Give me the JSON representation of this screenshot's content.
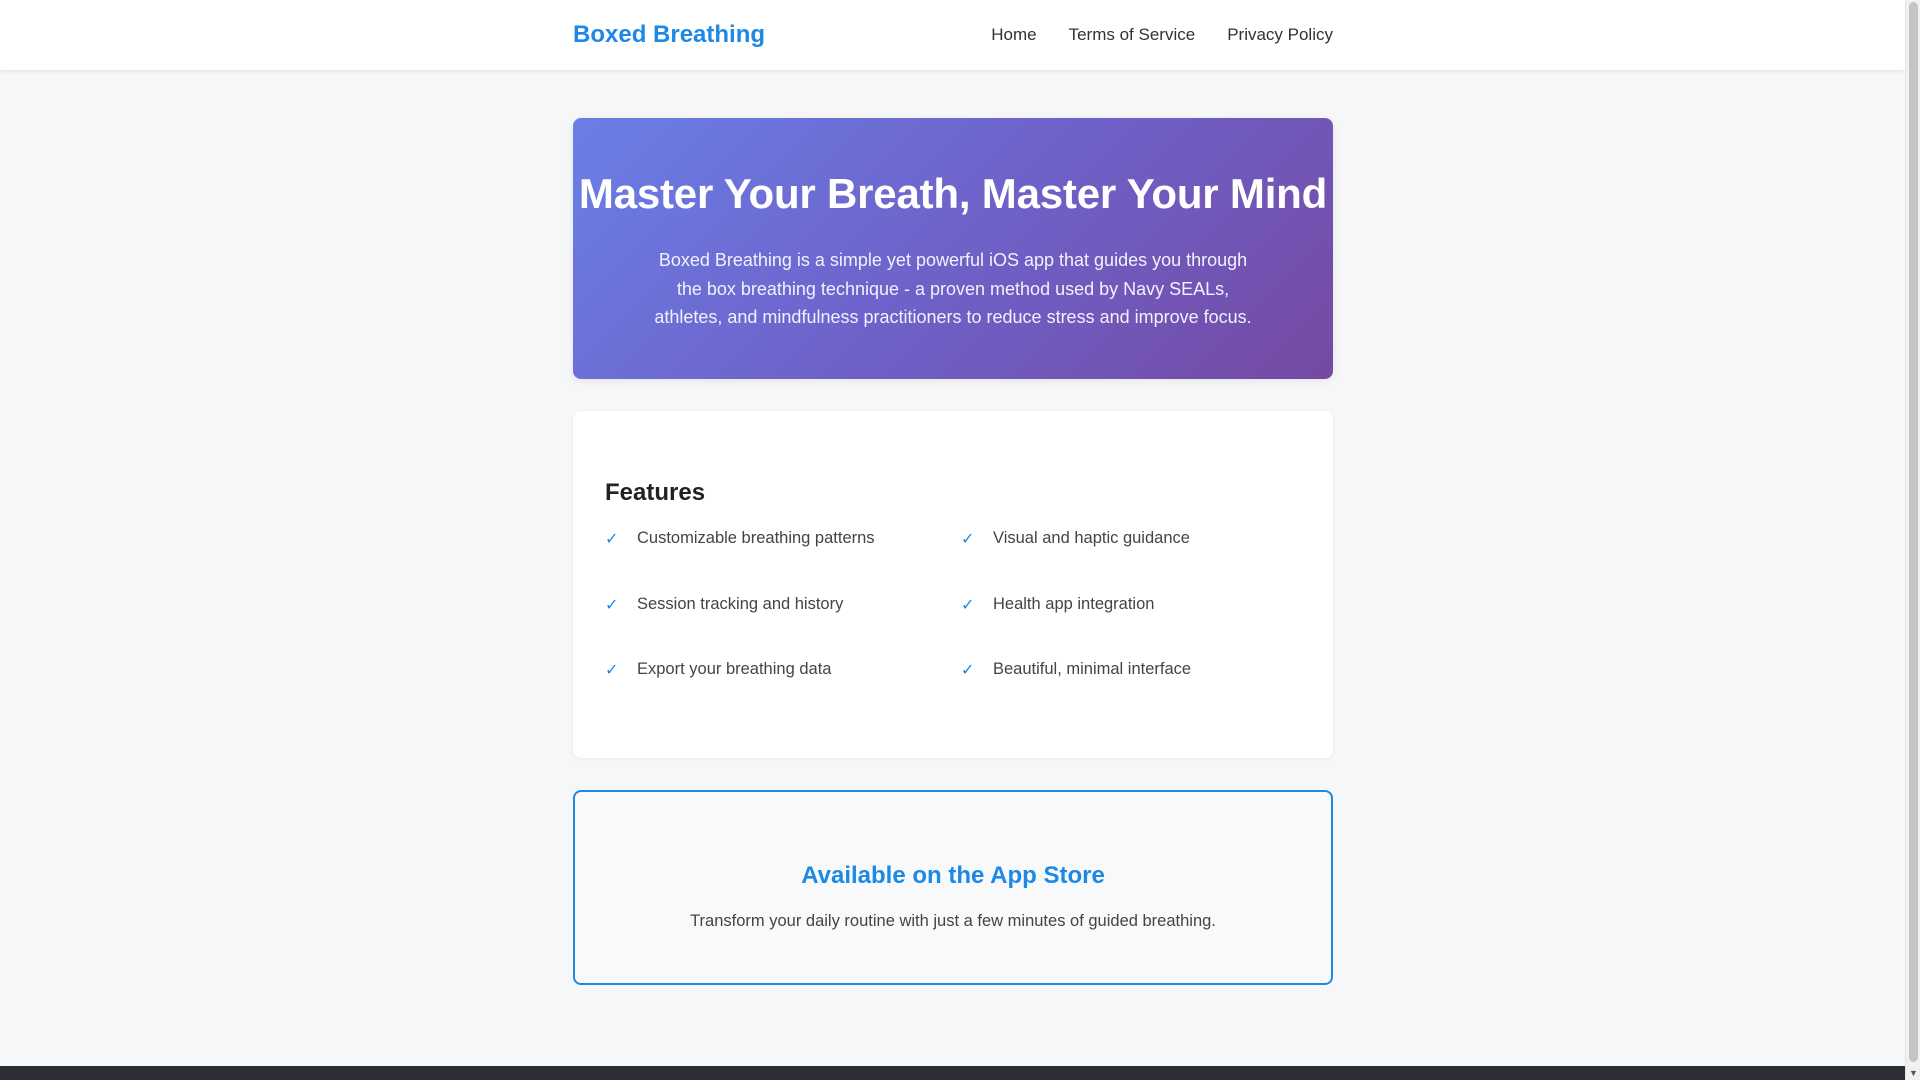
{
  "header": {
    "brand": "Boxed Breathing",
    "nav": [
      {
        "label": "Home"
      },
      {
        "label": "Terms of Service"
      },
      {
        "label": "Privacy Policy"
      }
    ]
  },
  "hero": {
    "title": "Master Your Breath, Master Your Mind",
    "description": "Boxed Breathing is a simple yet powerful iOS app that guides you through the box breathing technique - a proven method used by Navy SEALs, athletes, and mindfulness practitioners to reduce stress and improve focus."
  },
  "features": {
    "heading": "Features",
    "check_glyph": "✓",
    "items": [
      {
        "label": "Customizable breathing patterns"
      },
      {
        "label": "Visual and haptic guidance"
      },
      {
        "label": "Session tracking and history"
      },
      {
        "label": "Health app integration"
      },
      {
        "label": "Export your breathing data"
      },
      {
        "label": "Beautiful, minimal interface"
      }
    ]
  },
  "store": {
    "title": "Available on the App Store",
    "subtitle": "Transform your daily routine with just a few minutes of guided breathing."
  },
  "colors": {
    "accent": "#1e88e5",
    "hero_gradient_start": "#6a7fe6",
    "hero_gradient_end": "#7549a3",
    "footer": "#2b2f33"
  }
}
